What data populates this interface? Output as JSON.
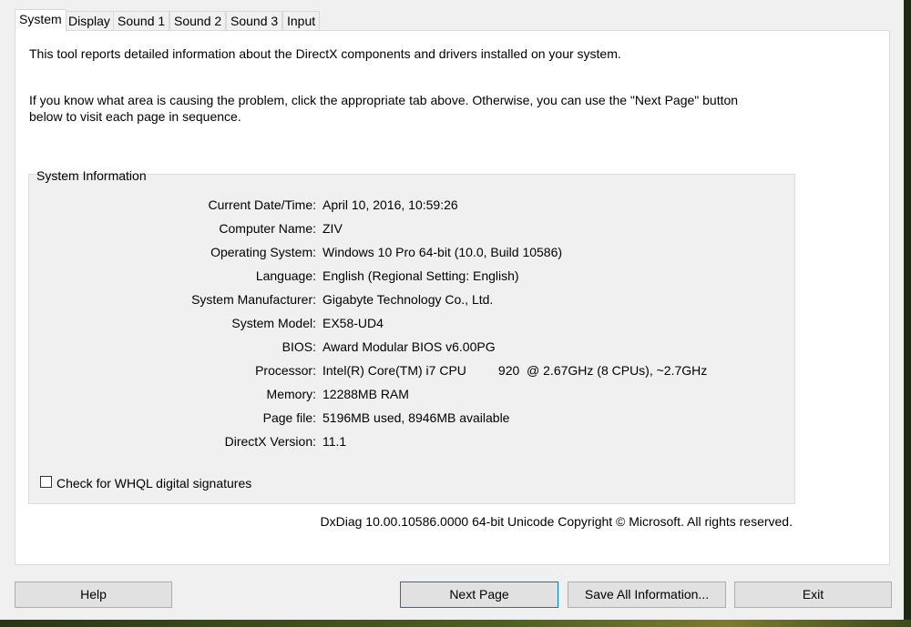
{
  "tabs": [
    {
      "label": "System",
      "active": true
    },
    {
      "label": "Display"
    },
    {
      "label": "Sound 1"
    },
    {
      "label": "Sound 2"
    },
    {
      "label": "Sound 3"
    },
    {
      "label": "Input"
    }
  ],
  "intro": {
    "line1": "This tool reports detailed information about the DirectX components and drivers installed on your system.",
    "line2": "If you know what area is causing the problem, click the appropriate tab above.  Otherwise, you can use the \"Next Page\" button",
    "line3": "below to visit each page in sequence."
  },
  "system_info": {
    "title": "System Information",
    "rows": [
      {
        "label": "Current Date/Time:",
        "value": "April 10, 2016, 10:59:26"
      },
      {
        "label": "Computer Name:",
        "value": "ZIV"
      },
      {
        "label": "Operating System:",
        "value": "Windows 10 Pro 64-bit (10.0, Build 10586)"
      },
      {
        "label": "Language:",
        "value": "English (Regional Setting: English)"
      },
      {
        "label": "System Manufacturer:",
        "value": "Gigabyte Technology Co., Ltd."
      },
      {
        "label": "System Model:",
        "value": "EX58-UD4"
      },
      {
        "label": "BIOS:",
        "value": "Award Modular BIOS v6.00PG"
      },
      {
        "label": "Processor:",
        "value": "Intel(R) Core(TM) i7 CPU         920  @ 2.67GHz (8 CPUs), ~2.7GHz"
      },
      {
        "label": "Memory:",
        "value": "12288MB RAM"
      },
      {
        "label": "Page file:",
        "value": "5196MB used, 8946MB available"
      },
      {
        "label": "DirectX Version:",
        "value": "11.1"
      }
    ],
    "whql_label": "Check for WHQL digital signatures",
    "whql_checked": false
  },
  "copyright": "DxDiag 10.00.10586.0000 64-bit Unicode  Copyright © Microsoft. All rights reserved.",
  "buttons": {
    "help": "Help",
    "next_page": "Next Page",
    "save_all": "Save All Information...",
    "exit": "Exit"
  },
  "colors": {
    "default_button_border": "#0078d7",
    "panel_background": "#ffffff",
    "window_background": "#f0f0f0"
  }
}
